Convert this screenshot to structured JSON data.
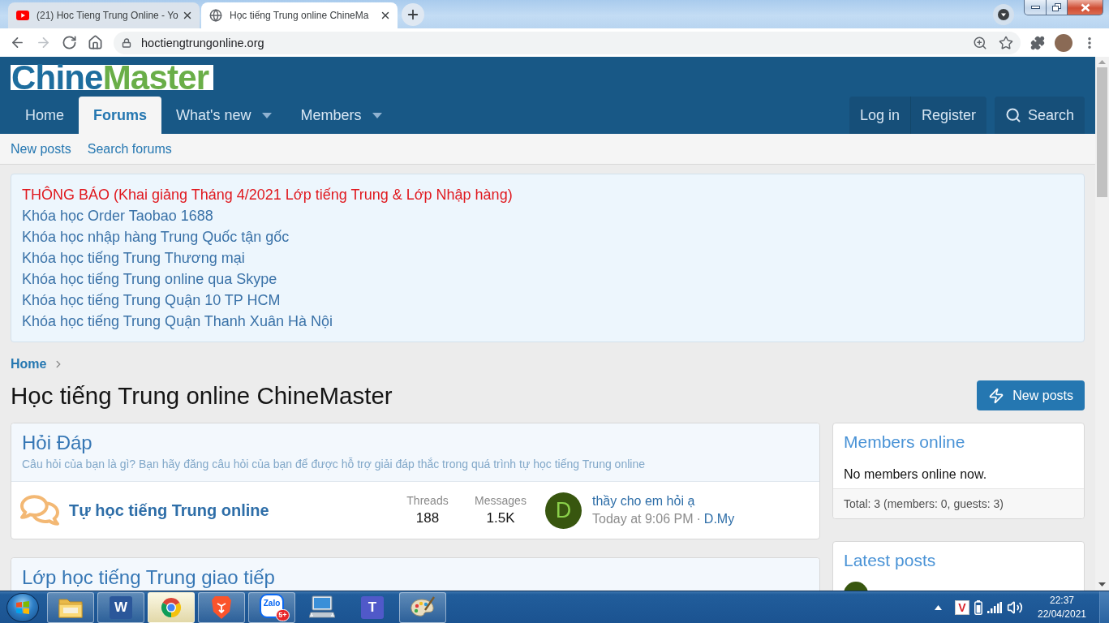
{
  "browser": {
    "tabs": [
      {
        "title": "(21) Hoc Tieng Trung Online - Yo",
        "kind": "video",
        "selected": false
      },
      {
        "title": "Học tiếng Trung online ChineMa",
        "kind": "globe",
        "selected": true
      }
    ],
    "nav_buttons": [
      {
        "kind": "back",
        "disabled": false
      },
      {
        "kind": "forward",
        "disabled": true
      },
      {
        "kind": "reload",
        "disabled": false
      },
      {
        "kind": "home",
        "disabled": false
      }
    ],
    "address": {
      "url": "hoctiengtrungonline.org"
    }
  },
  "header": {
    "logo": [
      {
        "text": "Chine",
        "color": "#1d6d9e"
      },
      {
        "text": "Master",
        "color": "#6aae48"
      }
    ],
    "nav": [
      {
        "label": "Home",
        "selected": false,
        "has_menu": false
      },
      {
        "label": "Forums",
        "selected": true,
        "has_menu": false
      },
      {
        "label": "What's new",
        "selected": false,
        "has_menu": true
      },
      {
        "label": "Members",
        "selected": false,
        "has_menu": true
      }
    ],
    "account": [
      "Log in",
      "Register"
    ],
    "search": "Search"
  },
  "subnav": [
    "New posts",
    "Search forums"
  ],
  "notice": [
    {
      "text": "THÔNG BÁO (Khai giảng Tháng 4/2021 Lớp tiếng Trung & Lớp Nhập hàng)",
      "color": "#e0191f"
    },
    {
      "text": "Khóa học Order Taobao 1688",
      "color": "#3a72a8"
    },
    {
      "text": "Khóa học nhập hàng Trung Quốc tận gốc",
      "color": "#3a72a8"
    },
    {
      "text": "Khóa học tiếng Trung Thương mại",
      "color": "#3a72a8"
    },
    {
      "text": "Khóa học tiếng Trung online qua Skype",
      "color": "#3a72a8"
    },
    {
      "text": "Khóa học tiếng Trung Quận 10 TP HCM",
      "color": "#3a72a8"
    },
    {
      "text": "Khóa học tiếng Trung Quận Thanh Xuân Hà Nội",
      "color": "#3a72a8"
    }
  ],
  "breadcrumb": [
    "Home"
  ],
  "page_title": "Học tiếng Trung online ChineMaster",
  "new_posts_button": "New posts",
  "categories": [
    {
      "title": "Hỏi Đáp",
      "description": "Câu hỏi của bạn là gì? Bạn hãy đăng câu hỏi của bạn để được hỗ trợ giải đáp thắc trong quá trình tự học tiếng Trung online",
      "forums": [
        {
          "title": "Tự học tiếng Trung online",
          "stats": [
            {
              "label": "Threads",
              "value": "188"
            },
            {
              "label": "Messages",
              "value": "1.5K"
            }
          ],
          "latest": {
            "avatar": "D",
            "title": "thầy cho em hỏi ạ",
            "time": "Today at 9:06 PM",
            "separator": "·",
            "author": "D.My"
          }
        }
      ]
    },
    {
      "title": "Lớp học tiếng Trung giao tiếp"
    }
  ],
  "sidebar": {
    "members_online": {
      "title": "Members online",
      "message": "No members online now.",
      "total": "Total: 3 (members: 0, guests: 3)"
    },
    "latest_posts": {
      "title": "Latest posts"
    }
  },
  "taskbar": {
    "apps": [
      {
        "kind": "folder",
        "running": true,
        "selected": false
      },
      {
        "kind": "document",
        "logo": "W",
        "running": true,
        "selected": false
      },
      {
        "kind": "browser",
        "running": true,
        "selected": true
      },
      {
        "kind": "shield",
        "running": true,
        "selected": false
      },
      {
        "kind": "chat",
        "logo": "Zalo",
        "badge": "5+",
        "running": true,
        "selected": false
      },
      {
        "kind": "computer",
        "running": false,
        "selected": false
      },
      {
        "kind": "team",
        "logo": "T",
        "running": false,
        "selected": false
      },
      {
        "kind": "palette",
        "running": true,
        "selected": false
      }
    ],
    "tray": [
      {
        "kind": "caret"
      },
      {
        "kind": "app",
        "logo": "V"
      },
      {
        "kind": "battery"
      },
      {
        "kind": "signal"
      },
      {
        "kind": "volume"
      }
    ],
    "clock": {
      "time": "22:37",
      "date": "22/04/2021"
    }
  }
}
